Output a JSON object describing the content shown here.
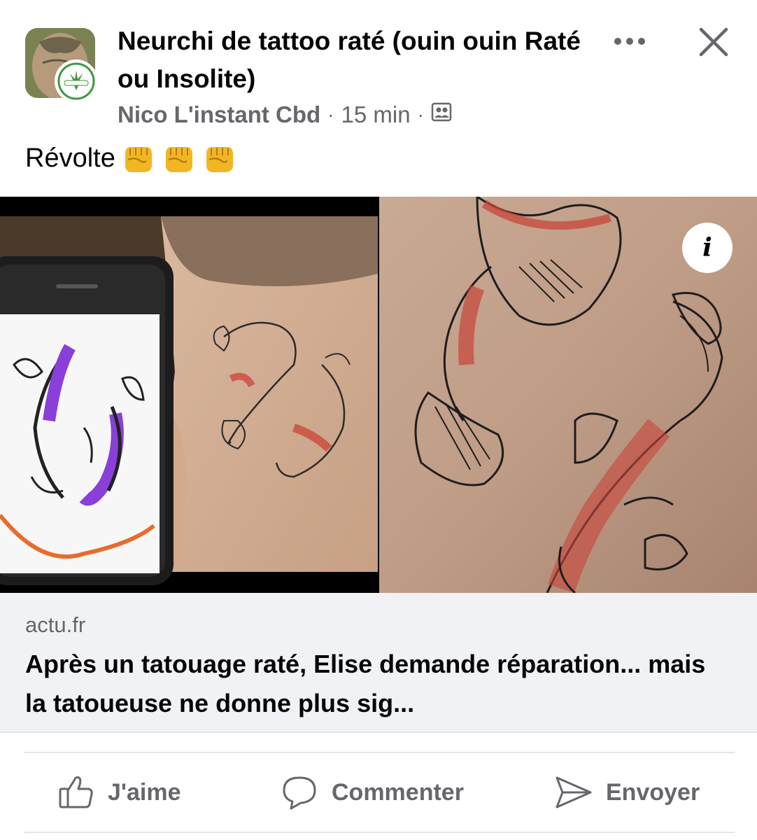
{
  "header": {
    "group_title": "Neurchi de tattoo raté (ouin ouin Raté ou Insolite)",
    "author": "Nico L'instant Cbd",
    "separator": "·",
    "time": "15 min",
    "avatar_badge_text": "L'instant CBD"
  },
  "post": {
    "text": "Révolte",
    "emoji": [
      "fist-emoji",
      "fist-emoji",
      "fist-emoji"
    ]
  },
  "media": {
    "info_label": "i"
  },
  "link_preview": {
    "domain": "actu.fr",
    "title": "Après un tatouage raté, Elise demande réparation... mais la tatoueuse ne donne plus sig..."
  },
  "actions": {
    "like": "J'aime",
    "comment": "Commenter",
    "send": "Envoyer"
  },
  "colors": {
    "secondary_text": "#65676b",
    "primary_text": "#050505",
    "preview_bg": "#f0f2f5",
    "divider": "#e4e6eb"
  }
}
